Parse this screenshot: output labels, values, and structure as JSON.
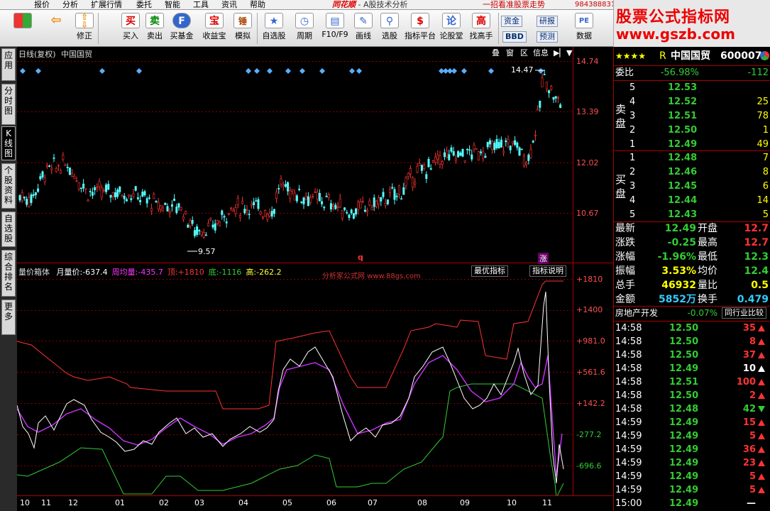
{
  "menu": {
    "items": [
      "报价",
      "分析",
      "扩展行情",
      "委托",
      "智能",
      "工具",
      "资讯",
      "帮助"
    ],
    "app_logo": "同花顺",
    "app_subtitle": "- A股技术分析",
    "promo": "一招看准股票走势",
    "phone": "984388831"
  },
  "toolbar": {
    "buttons": [
      {
        "label": "",
        "icon": "grid-icon"
      },
      {
        "label": "",
        "icon": "back-arrow-icon"
      },
      {
        "label": "修正",
        "icon": "up-down-arrow-icon"
      },
      {
        "label": "买入",
        "glyph": "买"
      },
      {
        "label": "卖出",
        "glyph": "卖"
      },
      {
        "label": "买基金",
        "glyph": "F"
      },
      {
        "label": "收益宝",
        "glyph": "宝"
      },
      {
        "label": "模拟",
        "glyph": "锤"
      },
      {
        "label": "自选股",
        "glyph": "★"
      },
      {
        "label": "周期",
        "glyph": "◷"
      },
      {
        "label": "F10/F9",
        "glyph": "▤"
      },
      {
        "label": "画线",
        "glyph": "✎"
      },
      {
        "label": "选股",
        "glyph": "⚲"
      },
      {
        "label": "指标平台",
        "glyph": "$"
      },
      {
        "label": "论股堂",
        "glyph": "论"
      },
      {
        "label": "找高手",
        "glyph": "高"
      }
    ],
    "fund_btn": "资金",
    "bbd_btn": "BBD",
    "research_btn": "研报",
    "forecast_btn": "预测",
    "data_btn": "数据",
    "pe_label": "PE"
  },
  "brand": {
    "line1": "股票公式指标网",
    "line2": "www.gszb.com"
  },
  "sidetabs": [
    {
      "label": "应用",
      "active": false
    },
    {
      "label": "分时图",
      "active": false
    },
    {
      "label": "K线图",
      "active": true
    },
    {
      "label": "个股资料",
      "active": false
    },
    {
      "label": "自选股",
      "active": false
    },
    {
      "label": "综合排名",
      "active": false
    },
    {
      "label": "更多",
      "active": false
    }
  ],
  "price_chart": {
    "header": "日线(复权)",
    "stock_name": "中国国贸",
    "controls": [
      "叠",
      "窗",
      "区",
      "信息"
    ],
    "high_label": "14.47",
    "low_label": "9.57",
    "y_ticks": [
      "14.74",
      "13.39",
      "12.02",
      "10.67"
    ],
    "marker_q": "q",
    "marker_zhang": "涨"
  },
  "indicator": {
    "name": "量价箱体",
    "items": [
      {
        "label": "月量价:",
        "value": "-637.4",
        "color": "#ffffff"
      },
      {
        "label": "周均量:",
        "value": "-435.7",
        "color": "#ff33ff"
      },
      {
        "label": "顶:",
        "value": "+1810",
        "color": "#ff3333"
      },
      {
        "label": "底:",
        "value": "-1116",
        "color": "#33cc33"
      },
      {
        "label": "高:",
        "value": "-262.2",
        "color": "#ffff33"
      }
    ],
    "watermark": "分析家公式网 www.88gs.com",
    "best_btn": "最优指标",
    "help_btn": "指标说明",
    "y_ticks": [
      "+1810",
      "+1400",
      "+981.0",
      "+561.6",
      "+142.2",
      "-277.2",
      "-696.6"
    ]
  },
  "x_axis": [
    "10",
    "11",
    "12",
    "01",
    "02",
    "03",
    "04",
    "05",
    "06",
    "07",
    "08",
    "09",
    "10",
    "11"
  ],
  "quote": {
    "stars": "★★★★",
    "flag": "R",
    "name": "中国国贸",
    "code": "600007",
    "wei_bi_label": "委比",
    "wei_bi": "-56.98%",
    "wei_cha": "-112",
    "sell_label": "卖盘",
    "buy_label": "买盘",
    "sell": [
      {
        "n": "5",
        "p": "12.53",
        "v": ""
      },
      {
        "n": "4",
        "p": "12.52",
        "v": "25"
      },
      {
        "n": "3",
        "p": "12.51",
        "v": "78"
      },
      {
        "n": "2",
        "p": "12.50",
        "v": "1"
      },
      {
        "n": "1",
        "p": "12.49",
        "v": "49"
      }
    ],
    "buy": [
      {
        "n": "1",
        "p": "12.48",
        "v": "7"
      },
      {
        "n": "2",
        "p": "12.46",
        "v": "8"
      },
      {
        "n": "3",
        "p": "12.45",
        "v": "6"
      },
      {
        "n": "4",
        "p": "12.44",
        "v": "14"
      },
      {
        "n": "5",
        "p": "12.43",
        "v": "5"
      }
    ],
    "stats": [
      {
        "l1": "最新",
        "v1": "12.49",
        "c1": "green",
        "l2": "开盘",
        "v2": "12.7",
        "c2": "red"
      },
      {
        "l1": "涨跌",
        "v1": "-0.25",
        "c1": "green",
        "l2": "最高",
        "v2": "12.7",
        "c2": "red"
      },
      {
        "l1": "涨幅",
        "v1": "-1.96%",
        "c1": "green",
        "l2": "最低",
        "v2": "12.3",
        "c2": "green"
      },
      {
        "l1": "振幅",
        "v1": "3.53%",
        "c1": "yellow",
        "l2": "均价",
        "v2": "12.4",
        "c2": "green"
      },
      {
        "l1": "总手",
        "v1": "46932",
        "c1": "yellow",
        "l2": "量比",
        "v2": "0.5",
        "c2": "yellow"
      },
      {
        "l1": "金额",
        "v1": "5852万",
        "c1": "cyan",
        "l2": "换手",
        "v2": "0.479",
        "c2": "cyan"
      }
    ],
    "sector": "房地产开发",
    "sector_chg": "-0.07%",
    "compare_btn": "同行业比较",
    "ticks": [
      {
        "t": "14:58",
        "p": "12.50",
        "v": "35",
        "d": "up",
        "c": "red"
      },
      {
        "t": "14:58",
        "p": "12.50",
        "v": "8",
        "d": "up",
        "c": "red"
      },
      {
        "t": "14:58",
        "p": "12.50",
        "v": "37",
        "d": "up",
        "c": "red"
      },
      {
        "t": "14:58",
        "p": "12.49",
        "v": "10",
        "d": "up",
        "c": "white"
      },
      {
        "t": "14:58",
        "p": "12.51",
        "v": "100",
        "d": "up",
        "c": "red"
      },
      {
        "t": "14:58",
        "p": "12.50",
        "v": "2",
        "d": "up",
        "c": "red"
      },
      {
        "t": "14:58",
        "p": "12.48",
        "v": "42",
        "d": "dn",
        "c": "green"
      },
      {
        "t": "14:59",
        "p": "12.49",
        "v": "15",
        "d": "up",
        "c": "red"
      },
      {
        "t": "14:59",
        "p": "12.49",
        "v": "5",
        "d": "up",
        "c": "red"
      },
      {
        "t": "14:59",
        "p": "12.49",
        "v": "36",
        "d": "up",
        "c": "red"
      },
      {
        "t": "14:59",
        "p": "12.49",
        "v": "23",
        "d": "up",
        "c": "red"
      },
      {
        "t": "14:59",
        "p": "12.49",
        "v": "5",
        "d": "up",
        "c": "red"
      },
      {
        "t": "14:59",
        "p": "12.49",
        "v": "5",
        "d": "up",
        "c": "red"
      },
      {
        "t": "15:00",
        "p": "12.49",
        "v": "—",
        "d": "",
        "c": "white"
      }
    ]
  }
}
